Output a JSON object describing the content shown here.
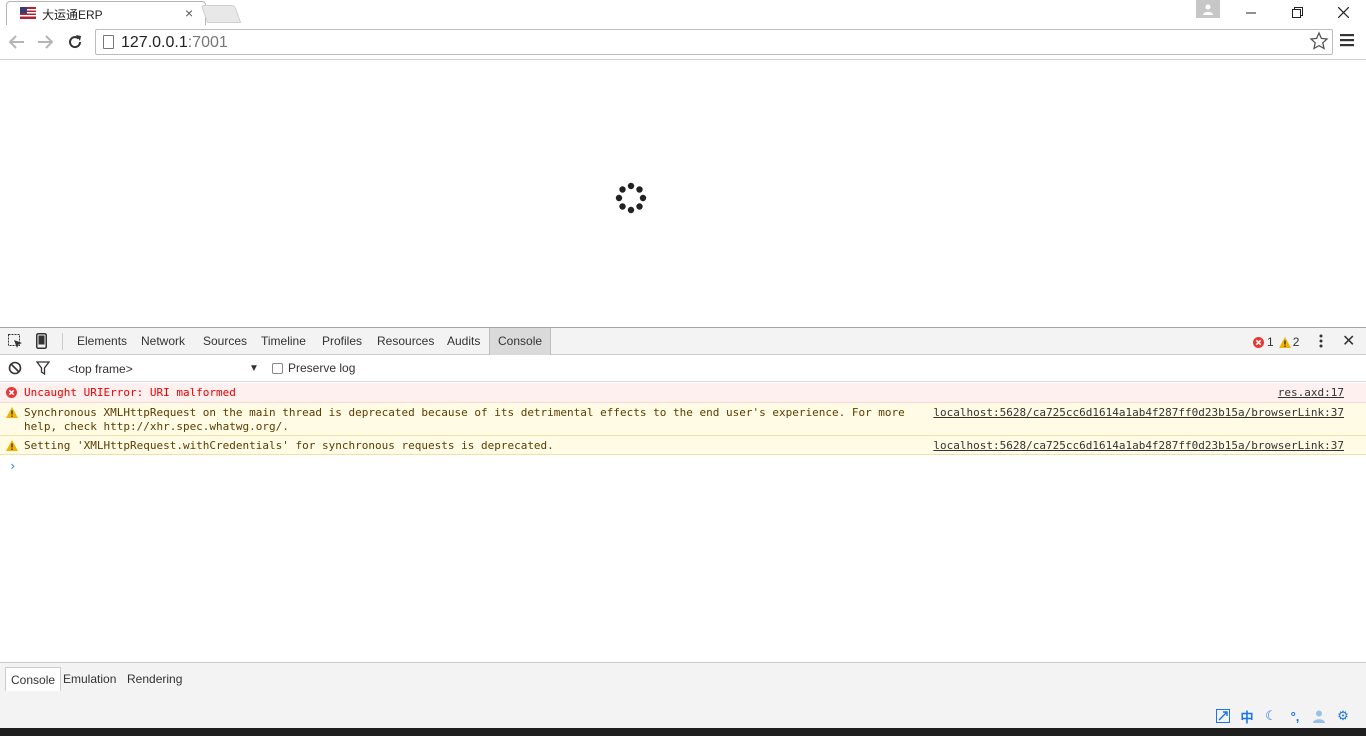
{
  "browser": {
    "tab_title": "大运通ERP",
    "tab_close": "×",
    "url_host": "127.0.0.1",
    "url_port": ":7001"
  },
  "devtools": {
    "tabs": [
      "Elements",
      "Network",
      "Sources",
      "Timeline",
      "Profiles",
      "Resources",
      "Audits",
      "Console"
    ],
    "active_tab": "Console",
    "error_count": "1",
    "warning_count": "2",
    "frame_select": "<top frame>",
    "preserve_log": "Preserve log",
    "messages": [
      {
        "level": "error",
        "text": "Uncaught URIError: URI malformed",
        "source": "res.axd:17"
      },
      {
        "level": "warning",
        "text": "Synchronous XMLHttpRequest on the main thread is deprecated because of its detrimental effects to the end user's experience. For more\nhelp, check http://xhr.spec.whatwg.org/.",
        "source": "localhost:5628/ca725cc6d1614a1ab4f287ff0d23b15a/browserLink:37"
      },
      {
        "level": "warning",
        "text": "Setting 'XMLHttpRequest.withCredentials' for synchronous requests is deprecated.",
        "source": "localhost:5628/ca725cc6d1614a1ab4f287ff0d23b15a/browserLink:37"
      }
    ],
    "prompt": "›",
    "drawer_tabs": [
      "Console",
      "Emulation",
      "Rendering"
    ]
  },
  "ime": {
    "lang": "中"
  },
  "colors": {
    "error": "#e00000",
    "warning": "#f0b400",
    "accent": "#1a73e8"
  }
}
